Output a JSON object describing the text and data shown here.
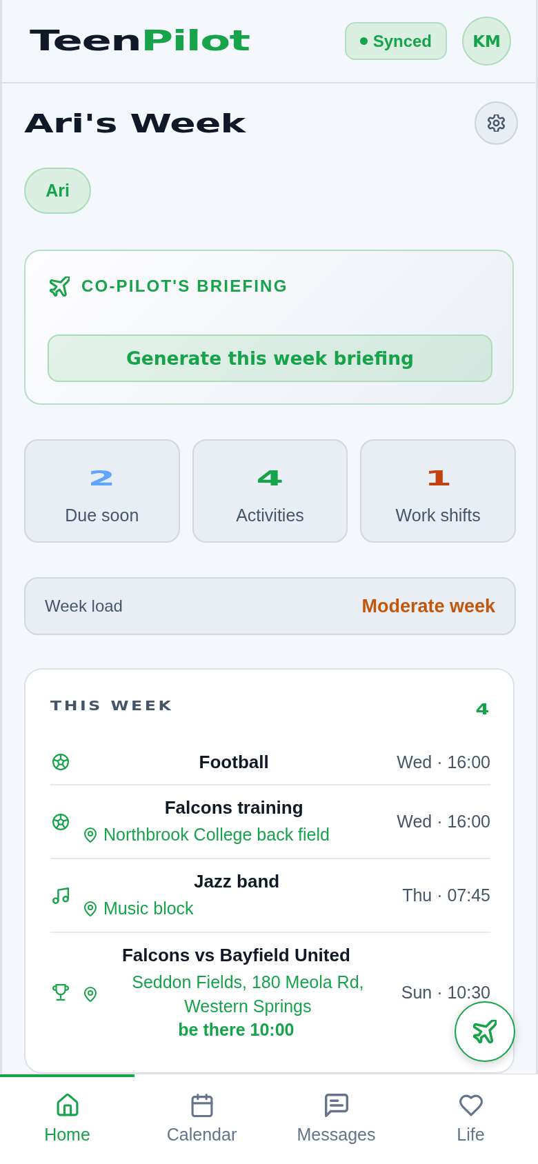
{
  "header": {
    "logo": [
      "Teen",
      "Pilot"
    ],
    "sync_status": "Synced",
    "avatar_initials": "KM"
  },
  "page": {
    "title": "Ari's Week"
  },
  "kids": [
    {
      "name": "Ari",
      "selected": true
    }
  ],
  "briefing": {
    "title": "CO-PILOT'S BRIEFING",
    "button": "Generate this week briefing"
  },
  "stats": [
    {
      "value": "2",
      "label": "Due soon",
      "color": "#60a5fa"
    },
    {
      "value": "4",
      "label": "Activities",
      "color": "#16a34a"
    },
    {
      "value": "1",
      "label": "Work shifts",
      "color": "#c2410c"
    }
  ],
  "week_load": {
    "label": "Week load",
    "value": "Moderate week"
  },
  "this_week": {
    "title": "THIS WEEK",
    "count": "4",
    "events": [
      {
        "kind": "sport",
        "title": "Football",
        "time": "Wed · 16:00"
      },
      {
        "kind": "sport",
        "title": "Falcons training",
        "location": "Northbrook College back field",
        "time": "Wed · 16:00"
      },
      {
        "kind": "music",
        "title": "Jazz band",
        "location": "Music block",
        "time": "Thu · 07:45"
      },
      {
        "kind": "match",
        "title": "Falcons vs Bayfield United",
        "location": "Seddon Fields, 180 Meola Rd, Western Springs",
        "note": "be there 10:00",
        "time": "Sun · 10:30"
      }
    ]
  },
  "nav": [
    {
      "label": "Home",
      "selected": true
    },
    {
      "label": "Calendar",
      "selected": false
    },
    {
      "label": "Messages",
      "selected": false
    },
    {
      "label": "Life",
      "selected": false
    }
  ]
}
